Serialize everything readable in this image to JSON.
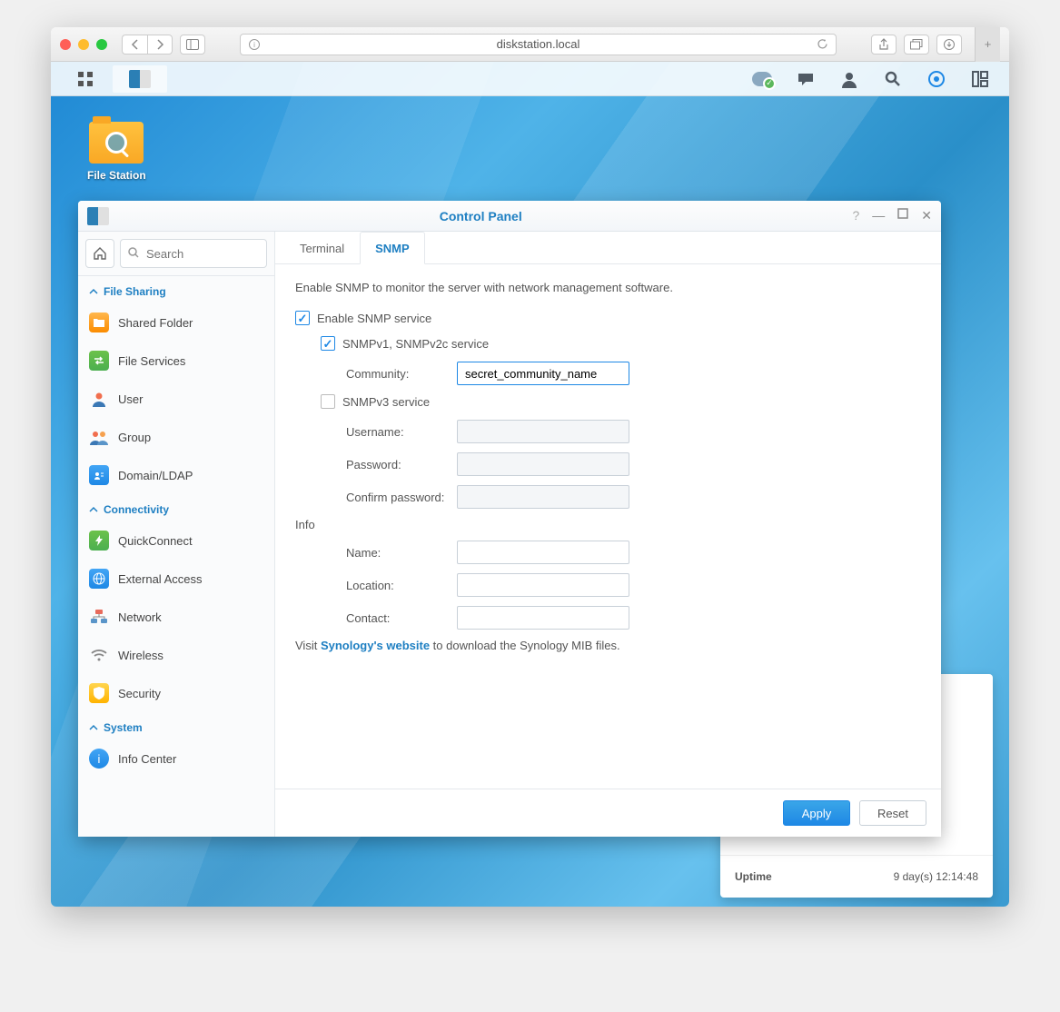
{
  "browser": {
    "url": "diskstation.local"
  },
  "desktop": {
    "file_station": "File Station"
  },
  "cp": {
    "title": "Control Panel",
    "search_placeholder": "Search",
    "sections": {
      "file_sharing": "File Sharing",
      "connectivity": "Connectivity",
      "system": "System"
    },
    "items": {
      "shared_folder": "Shared Folder",
      "file_services": "File Services",
      "user": "User",
      "group": "Group",
      "domain_ldap": "Domain/LDAP",
      "quickconnect": "QuickConnect",
      "external_access": "External Access",
      "network": "Network",
      "wireless": "Wireless",
      "security": "Security",
      "info_center": "Info Center"
    },
    "tabs": {
      "terminal": "Terminal",
      "snmp": "SNMP"
    },
    "snmp": {
      "desc": "Enable SNMP to monitor the server with network management software.",
      "enable": "Enable SNMP service",
      "v12c": "SNMPv1, SNMPv2c service",
      "community_label": "Community:",
      "community_value": "secret_community_name",
      "v3": "SNMPv3 service",
      "username_label": "Username:",
      "password_label": "Password:",
      "confirm_label": "Confirm password:",
      "info_header": "Info",
      "name_label": "Name:",
      "location_label": "Location:",
      "contact_label": "Contact:",
      "mib_prefix": "Visit ",
      "mib_link": "Synology's website",
      "mib_suffix": " to download the Synology MIB files."
    },
    "buttons": {
      "apply": "Apply",
      "reset": "Reset"
    }
  },
  "widget": {
    "uptime_label": "Uptime",
    "uptime_value": "9 day(s) 12:14:48"
  }
}
